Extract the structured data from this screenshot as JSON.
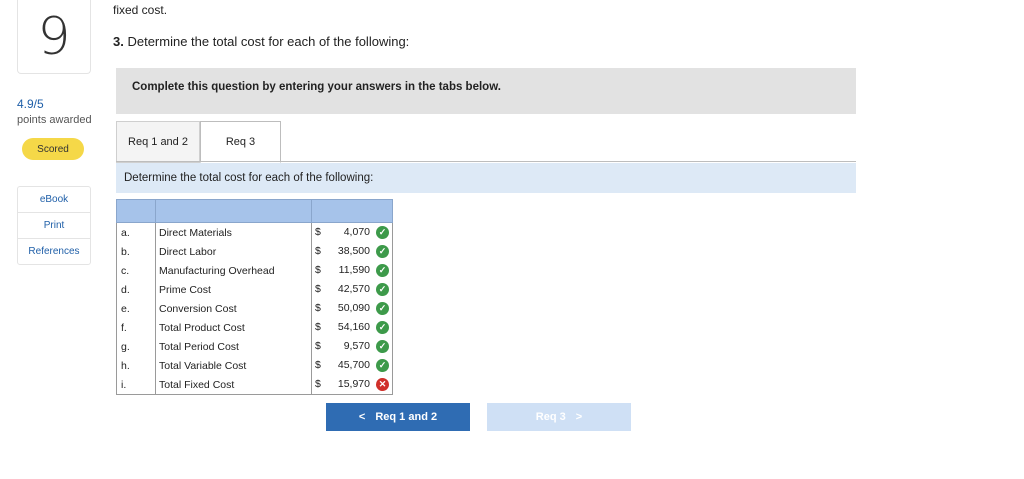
{
  "sidebar": {
    "question_number": "9",
    "score": "4.9/5",
    "points_label": "points awarded",
    "status_pill": "Scored",
    "resources": [
      "eBook",
      "Print",
      "References"
    ]
  },
  "main": {
    "partial_text": "fixed cost.",
    "q3_num": "3.",
    "q3_text": "Determine the total cost for each of the following:",
    "instruction": "Complete this question by entering your answers in the tabs below.",
    "tabs": [
      {
        "label": "Req 1 and 2"
      },
      {
        "label": "Req 3"
      }
    ],
    "tab_heading": "Determine the total cost for each of the following:",
    "rows": [
      {
        "letter": "a.",
        "name": "Direct Materials",
        "currency": "$",
        "value": "4,070",
        "status": "correct"
      },
      {
        "letter": "b.",
        "name": "Direct Labor",
        "currency": "$",
        "value": "38,500",
        "status": "correct"
      },
      {
        "letter": "c.",
        "name": "Manufacturing Overhead",
        "currency": "$",
        "value": "11,590",
        "status": "correct"
      },
      {
        "letter": "d.",
        "name": "Prime Cost",
        "currency": "$",
        "value": "42,570",
        "status": "correct"
      },
      {
        "letter": "e.",
        "name": "Conversion Cost",
        "currency": "$",
        "value": "50,090",
        "status": "correct"
      },
      {
        "letter": "f.",
        "name": "Total Product Cost",
        "currency": "$",
        "value": "54,160",
        "status": "correct"
      },
      {
        "letter": "g.",
        "name": "Total Period Cost",
        "currency": "$",
        "value": "9,570",
        "status": "correct"
      },
      {
        "letter": "h.",
        "name": "Total Variable Cost",
        "currency": "$",
        "value": "45,700",
        "status": "correct"
      },
      {
        "letter": "i.",
        "name": "Total Fixed Cost",
        "currency": "$",
        "value": "15,970",
        "status": "incorrect"
      }
    ],
    "nav": {
      "prev_label": "Req 1 and 2",
      "next_label": "Req 3",
      "prev_arrow": "<",
      "next_arrow": ">"
    },
    "colors": {
      "accent": "#2f6cb3",
      "correct": "#3d9a4a",
      "incorrect": "#d0302a",
      "pill": "#f5d848"
    }
  }
}
